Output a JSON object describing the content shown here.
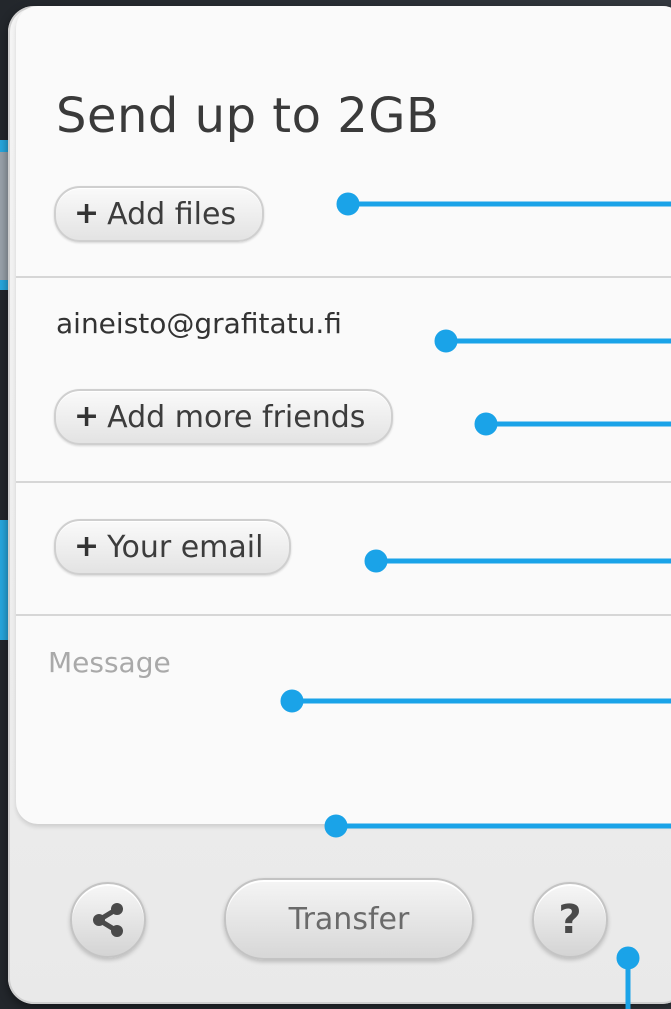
{
  "panel": {
    "title": "Send up to 2GB",
    "add_files_label": "Add files",
    "recipient_email": "aineisto@grafitatu.fi",
    "add_friends_label": "Add more friends",
    "your_email_label": "Your email",
    "message_placeholder": "Message",
    "plus_glyph": "+"
  },
  "toolbar": {
    "transfer_label": "Transfer",
    "help_glyph": "?",
    "share_icon": "share-icon",
    "help_icon": "help-icon"
  },
  "colors": {
    "accent": "#1aa3e8",
    "panel_bg": "#f4f4f4",
    "text": "#3a3a3a",
    "placeholder": "#a9a9a9"
  }
}
